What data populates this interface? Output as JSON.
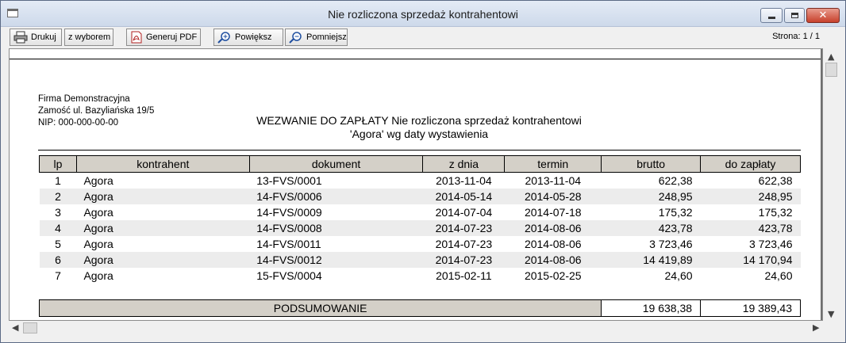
{
  "window": {
    "title": "Nie rozliczona sprzedaż kontrahentowi"
  },
  "toolbar": {
    "print_label": "Drukuj",
    "selection_label": "z wyborem",
    "pdf_label": "Generuj PDF",
    "zoom_in_label": "Powiększ",
    "zoom_out_label": "Pomniejsz",
    "page_indicator": "Strona: 1 / 1"
  },
  "report": {
    "company": {
      "name": "Firma Demonstracyjna",
      "address": "Zamość ul. Bazyliańska 19/5",
      "nip": "NIP: 000-000-00-00"
    },
    "title_line1": "WEZWANIE DO ZAPŁATY Nie rozliczona sprzedaż kontrahentowi",
    "title_line2": "'Agora' wg daty wystawienia",
    "columns": [
      "lp",
      "kontrahent",
      "dokument",
      "z dnia",
      "termin",
      "brutto",
      "do zapłaty"
    ],
    "rows": [
      [
        "1",
        "Agora",
        "13-FVS/0001",
        "2013-11-04",
        "2013-11-04",
        "622,38",
        "622,38"
      ],
      [
        "2",
        "Agora",
        "14-FVS/0006",
        "2014-05-14",
        "2014-05-28",
        "248,95",
        "248,95"
      ],
      [
        "3",
        "Agora",
        "14-FVS/0009",
        "2014-07-04",
        "2014-07-18",
        "175,32",
        "175,32"
      ],
      [
        "4",
        "Agora",
        "14-FVS/0008",
        "2014-07-23",
        "2014-08-06",
        "423,78",
        "423,78"
      ],
      [
        "5",
        "Agora",
        "14-FVS/0011",
        "2014-07-23",
        "2014-08-06",
        "3 723,46",
        "3 723,46"
      ],
      [
        "6",
        "Agora",
        "14-FVS/0012",
        "2014-07-23",
        "2014-08-06",
        "14 419,89",
        "14 170,94"
      ],
      [
        "7",
        "Agora",
        "15-FVS/0004",
        "2015-02-11",
        "2015-02-25",
        "24,60",
        "24,60"
      ]
    ],
    "summary": {
      "label": "PODSUMOWANIE",
      "brutto": "19 638,38",
      "do_zaplaty": "19 389,43"
    }
  },
  "colors": {
    "header_bg": "#d4d0c8",
    "stripe": "#ececec",
    "titlebar": "#cdd9ea",
    "close": "#c7402b"
  }
}
